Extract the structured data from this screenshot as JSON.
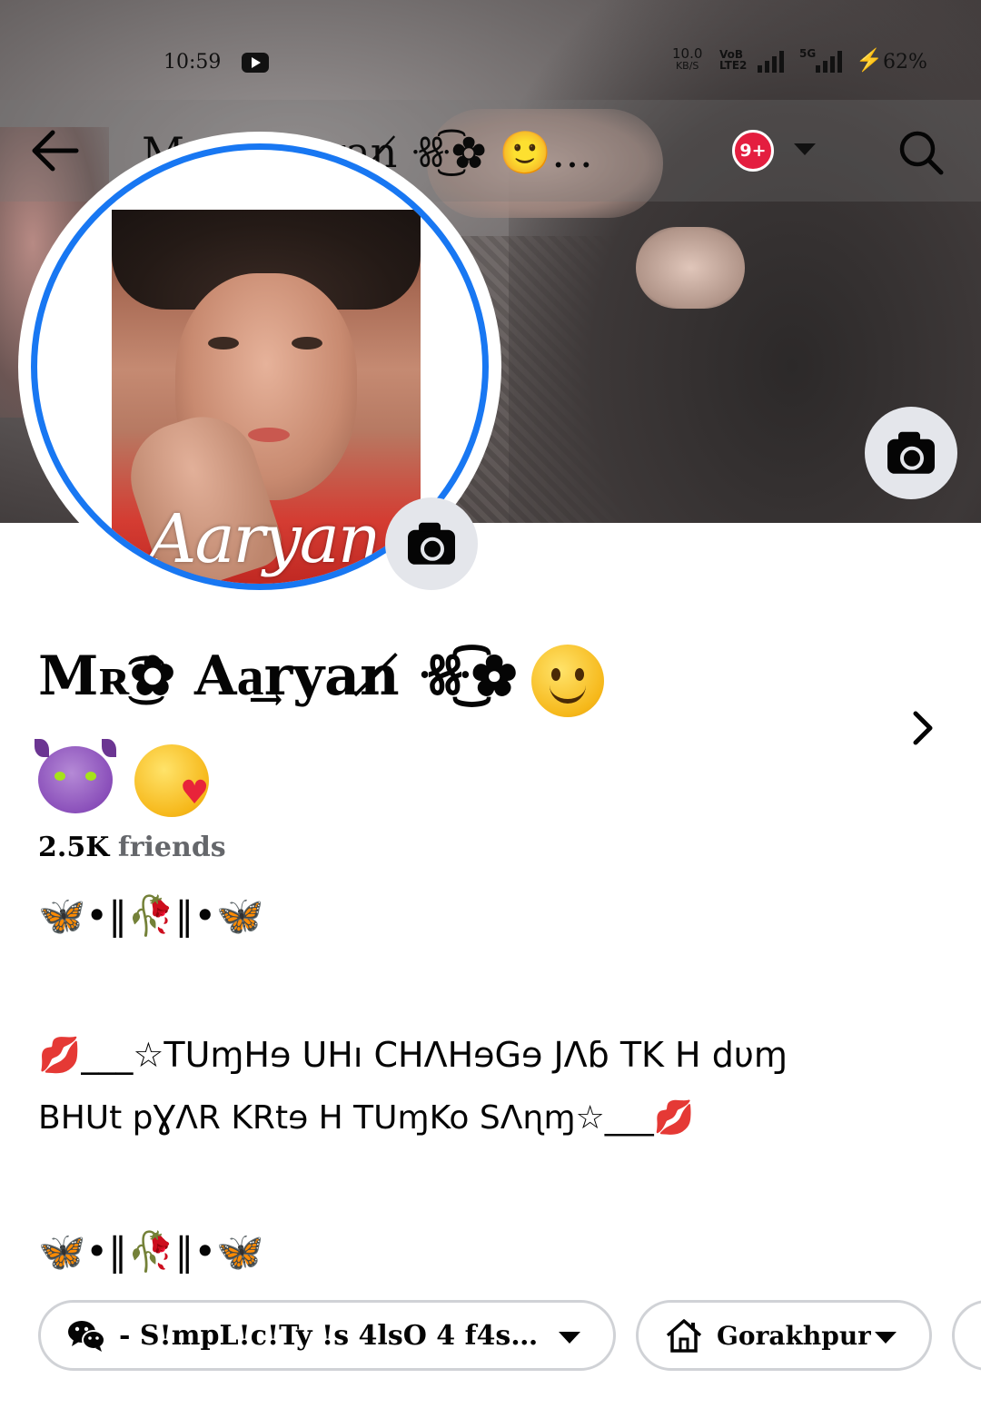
{
  "status_bar": {
    "time": "10:59",
    "net_speed_value": "10.0",
    "net_speed_unit": "KB/S",
    "volte": "VoB LTE2",
    "network_5g": "5G",
    "battery": "62%"
  },
  "header": {
    "title": "Mʀ͜͡✿ Aa͢ryan̸ ꗥ͜͡✿ 🙂…",
    "notification_badge": "9+",
    "accent_color": "#1877f2",
    "badge_color": "#e41e3f"
  },
  "profile": {
    "avatar_signature": "Aaryan",
    "name": "Mʀ͜͡✿ Aa͢ryan̸ ꗥ͜͡✿",
    "friends_count": "2.5K",
    "friends_label": "friends"
  },
  "bio": {
    "deco_1": "🦋•‖🥀‖•🦋",
    "text_1": "💋___☆TUɱHɘ UHı CHɅHɘGɘ JɅɓ TK H dυɱ",
    "text_2": "BHUt pƔɅR KRtɘ H TUɱKo SɅɳɱ☆___💋",
    "deco_2": "🦋•‖🥀‖•🦋"
  },
  "details": {
    "wechat_text": "- S!mpL!c!Ty !s 4lsO 4 f4sh...",
    "hometown_text": "Gorakhpur"
  },
  "icons": [
    "back-arrow-icon",
    "youtube-icon",
    "search-icon",
    "camera-icon",
    "chevron-right-icon",
    "wechat-icon",
    "home-icon",
    "caret-down-icon"
  ]
}
